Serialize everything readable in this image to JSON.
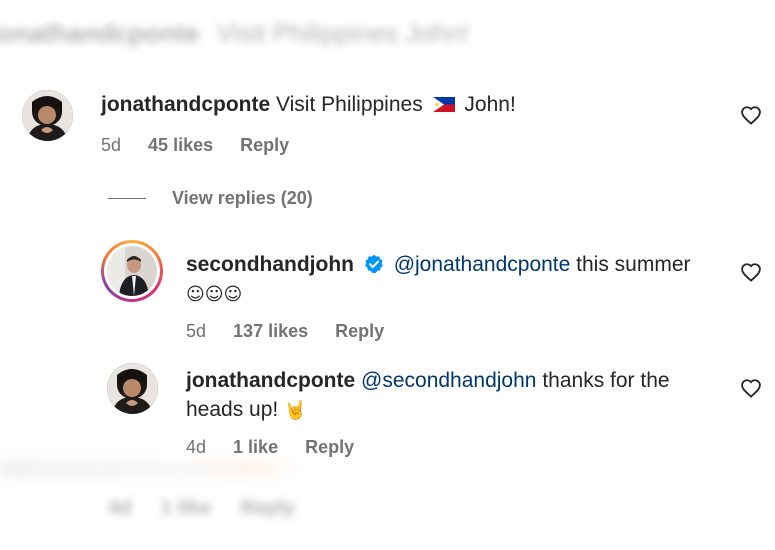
{
  "blurred_top": {
    "username": "jonathandcponte",
    "text": "Visit Philippines",
    "suffix": "John!"
  },
  "comment1": {
    "username": "jonathandcponte",
    "text": "Visit Philippines",
    "flag": "philippines-flag",
    "text_after_flag": "John!",
    "time": "5d",
    "likes": "45 likes",
    "reply": "Reply"
  },
  "view_replies": "View replies (20)",
  "reply1": {
    "username": "secondhandjohn",
    "verified": true,
    "mention": "@jonathandcponte",
    "text": " this summer",
    "emojis": "☺☺☺",
    "time": "5d",
    "likes": "137 likes",
    "reply": "Reply",
    "story_ring": true
  },
  "reply2": {
    "username": "jonathandcponte",
    "mention": "@secondhandjohn",
    "text": " thanks for the heads up! ",
    "emoji": "🤘",
    "time": "4d",
    "likes": "1 like",
    "reply": "Reply"
  },
  "blurred_bottom": {
    "time": "4d",
    "likes": "1 like",
    "reply": "Reply"
  },
  "colors": {
    "text": "#262626",
    "secondary": "#737373",
    "mention": "#00376b",
    "verified": "#0095f6"
  }
}
